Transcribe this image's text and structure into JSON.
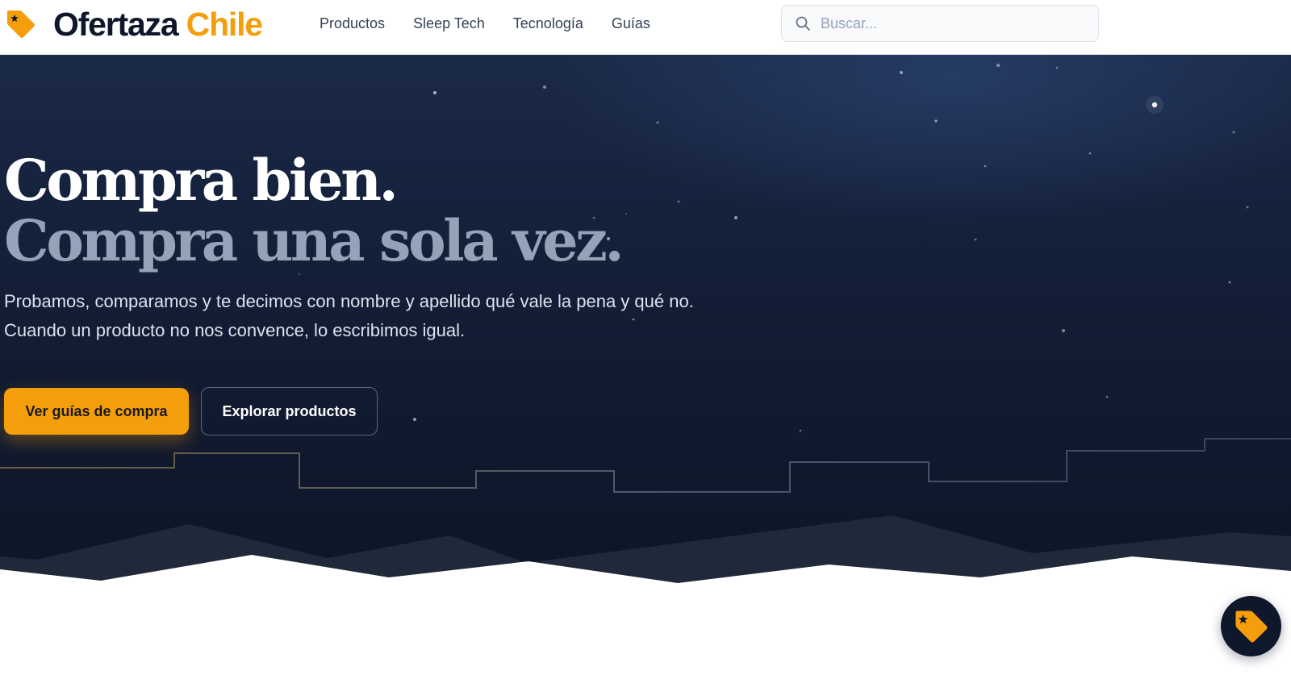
{
  "brand": {
    "name_part1": "Ofertaza",
    "name_part2": "Chile",
    "accent_color": "#f59e0b",
    "dark_color": "#0f172a",
    "icon": "price-tag-star-icon"
  },
  "nav": {
    "items": [
      {
        "label": "Productos"
      },
      {
        "label": "Sleep Tech"
      },
      {
        "label": "Tecnología"
      },
      {
        "label": "Guías"
      }
    ]
  },
  "search": {
    "placeholder": "Buscar...",
    "value": "",
    "icon": "search-icon"
  },
  "hero": {
    "title_line1": "Compra bien.",
    "title_line2": "Compra una sola vez.",
    "subtitle_line1": "Probamos, comparamos y te decimos con nombre y apellido qué vale la pena y qué no.",
    "subtitle_line2": "Cuando un producto no nos convence, lo escribimos igual.",
    "primary_cta": "Ver guías de compra",
    "secondary_cta": "Explorar productos",
    "background_color": "#111a30"
  },
  "floating_button": {
    "icon": "price-tag-star-icon"
  }
}
